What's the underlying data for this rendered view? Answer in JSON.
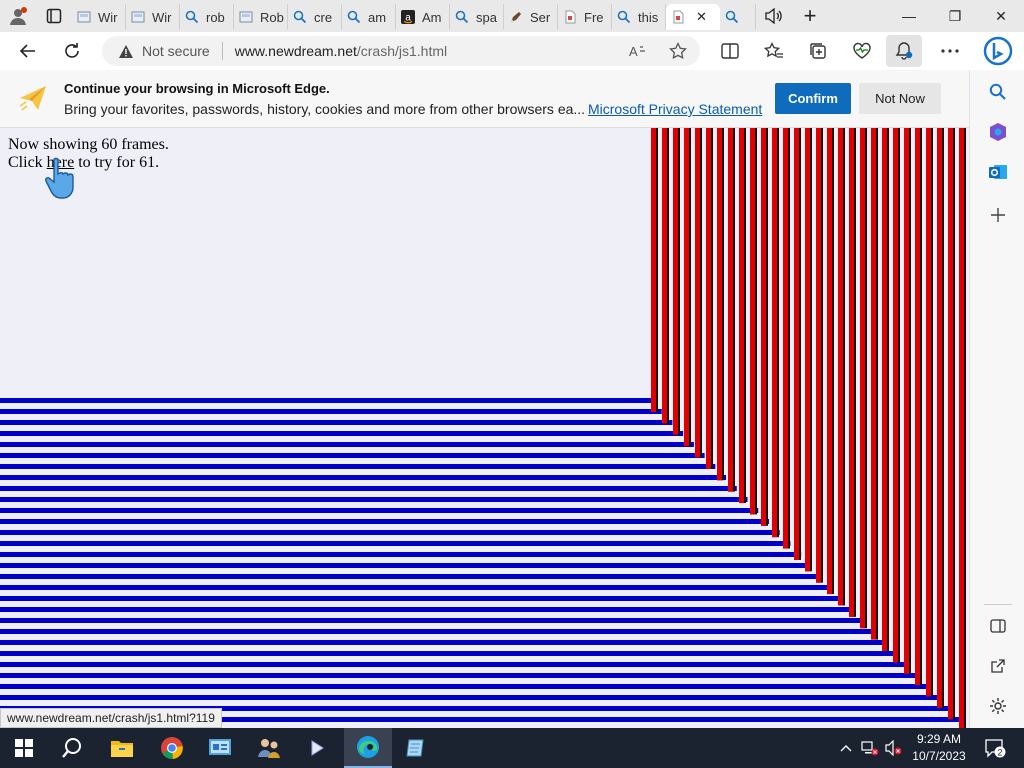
{
  "browser": {
    "tabs": [
      {
        "label": "",
        "icon": "profile-avatar-icon"
      },
      {
        "label": "",
        "icon": "tab-actions-icon"
      },
      {
        "label": "Wir",
        "icon": "page-thumbnail-icon"
      },
      {
        "label": "Wir",
        "icon": "page-thumbnail-icon"
      },
      {
        "label": "rob",
        "icon": "search-icon"
      },
      {
        "label": "Rob",
        "icon": "page-thumbnail-icon"
      },
      {
        "label": "cre",
        "icon": "search-icon"
      },
      {
        "label": "am",
        "icon": "search-icon"
      },
      {
        "label": "Am",
        "icon": "amazon-icon"
      },
      {
        "label": "spa",
        "icon": "search-icon"
      },
      {
        "label": "Ser",
        "icon": "pen-icon"
      },
      {
        "label": "Fre",
        "icon": "page-icon"
      },
      {
        "label": "this",
        "icon": "search-icon"
      },
      {
        "label": "",
        "icon": "page-icon"
      },
      {
        "label": "",
        "icon": "search-icon"
      }
    ],
    "active_tab_close": "✕",
    "new_tab": "+",
    "window": {
      "minimize": "—",
      "restore": "❐",
      "close": "✕"
    },
    "address": {
      "security_label": "Not secure",
      "host": "www.newdream.net",
      "path": "/crash/js1.html"
    }
  },
  "infobar": {
    "title": "Continue your browsing in Microsoft Edge.",
    "description": "Bring your favorites, passwords, history, cookies and more from other browsers ea...",
    "privacy_link": "Microsoft Privacy Statement",
    "confirm_label": "Confirm",
    "not_now_label": "Not Now"
  },
  "page": {
    "line1": "Now showing 60 frames.",
    "line2_before": "Click ",
    "line2_link": "here",
    "line2_after": " to try for 61.",
    "frames": 60,
    "colors": {
      "background": "#efeff8",
      "blue": "#0000c8",
      "red": "#e00000",
      "dark": "#111111"
    }
  },
  "status_url": "www.newdream.net/crash/js1.html?119",
  "taskbar": {
    "time": "9:29 AM",
    "date": "10/7/2023",
    "notification_count": "2",
    "apps": [
      "start-icon",
      "search-icon",
      "file-explorer-icon",
      "chrome-icon",
      "control-panel-icon",
      "users-icon",
      "terminal-icon",
      "edge-icon",
      "notepad-icon"
    ]
  }
}
